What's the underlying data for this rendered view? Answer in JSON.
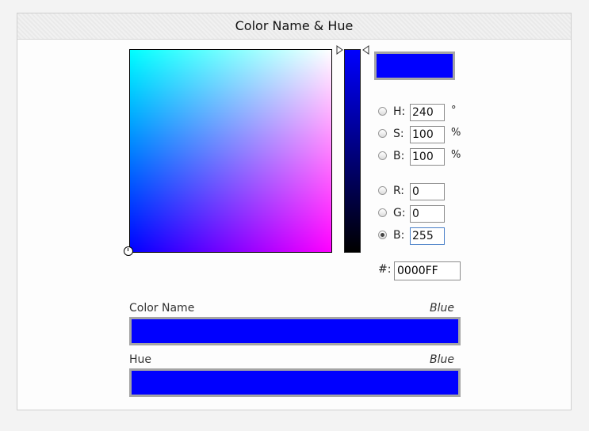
{
  "panel": {
    "title": "Color Name & Hue"
  },
  "picker": {
    "current_color": "#0000FF",
    "hue_gradient_top": "#0000ff",
    "hue_gradient_bottom": "#000000"
  },
  "fields": {
    "h": {
      "label": "H:",
      "value": "240",
      "unit": "°",
      "checked": false
    },
    "s": {
      "label": "S:",
      "value": "100",
      "unit": "%",
      "checked": false
    },
    "b": {
      "label": "B:",
      "value": "100",
      "unit": "%",
      "checked": false
    },
    "r": {
      "label": "R:",
      "value": "0",
      "checked": false
    },
    "g": {
      "label": "G:",
      "value": "0",
      "checked": false
    },
    "bb": {
      "label": "B:",
      "value": "255",
      "checked": true
    }
  },
  "hex": {
    "label": "#:",
    "value": "0000FF"
  },
  "color_name": {
    "label": "Color Name",
    "value": "Blue",
    "swatch": "#0000FF"
  },
  "hue": {
    "label": "Hue",
    "value": "Blue",
    "swatch": "#0000FF"
  }
}
